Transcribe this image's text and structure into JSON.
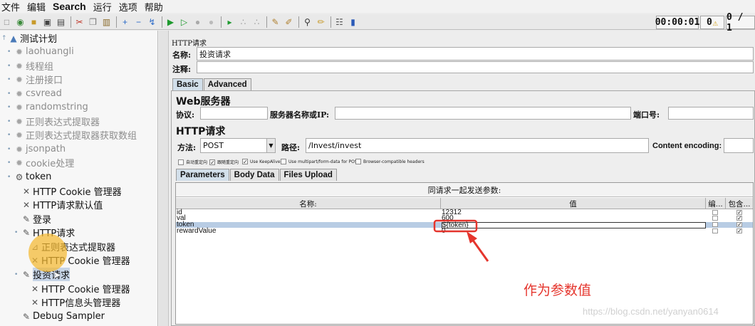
{
  "menu": {
    "file": "文件",
    "edit": "编辑",
    "search": "Search",
    "run": "运行",
    "options": "选项",
    "help": "帮助"
  },
  "status": {
    "elapsed": "00:00:01",
    "warnings": "0",
    "threads": "0 / 1"
  },
  "tree": {
    "root": "测试计划",
    "items": [
      {
        "label": "laohuangli"
      },
      {
        "label": "线程组"
      },
      {
        "label": "注册接口"
      },
      {
        "label": "csvread"
      },
      {
        "label": "randomstring"
      },
      {
        "label": "正则表达式提取器"
      },
      {
        "label": "正则表达式提取器获取数组"
      },
      {
        "label": "jsonpath"
      },
      {
        "label": "cookie处理"
      },
      {
        "label": "token"
      },
      {
        "label": "HTTP Cookie 管理器"
      },
      {
        "label": "HTTP请求默认值"
      },
      {
        "label": "登录"
      },
      {
        "label": "HTTP请求"
      },
      {
        "label": "正则表达式提取器"
      },
      {
        "label": "HTTP Cookie 管理器"
      },
      {
        "label": "投资请求"
      },
      {
        "label": "HTTP Cookie 管理器"
      },
      {
        "label": "HTTP信息头管理器"
      },
      {
        "label": "Debug Sampler"
      }
    ]
  },
  "sampler": {
    "header": "HTTP请求",
    "name_label": "名称:",
    "name_value": "投资请求",
    "comment_label": "注释:",
    "tab_basic": "Basic",
    "tab_advanced": "Advanced",
    "web_server_title": "Web服务器",
    "protocol_label": "协议:",
    "server_label": "服务器名称或IP:",
    "port_label": "端口号:",
    "http_request_title": "HTTP请求",
    "method_label": "方法:",
    "method_value": "POST",
    "path_label": "路径:",
    "path_value": "/Invest/invest",
    "encoding_label": "Content encoding:",
    "options": {
      "redirect_auto": "自动重定向",
      "follow_redirects": "跟随重定向",
      "keepalive": "Use KeepAlive",
      "multipart": "Use multipart/form-data for POST",
      "browser_headers": "Browser-compatible headers"
    },
    "tab_parameters": "Parameters",
    "tab_body": "Body Data",
    "tab_files": "Files Upload",
    "params_caption": "同请求一起发送参数:",
    "col_name": "名称:",
    "col_value": "值",
    "col_encode": "编...",
    "col_include": "包含...",
    "params": [
      {
        "name": "id",
        "value": "12312"
      },
      {
        "name": "val",
        "value": "600"
      },
      {
        "name": "token",
        "value": "${token}"
      },
      {
        "name": "rewardValue",
        "value": "0"
      }
    ]
  },
  "annotation": "作为参数值",
  "watermark": "https://blog.csdn.net/yanyan0614",
  "colors": {
    "annotation": "#e5352d",
    "highlight": "#f4b830",
    "selected_row": "#b8cce4"
  }
}
